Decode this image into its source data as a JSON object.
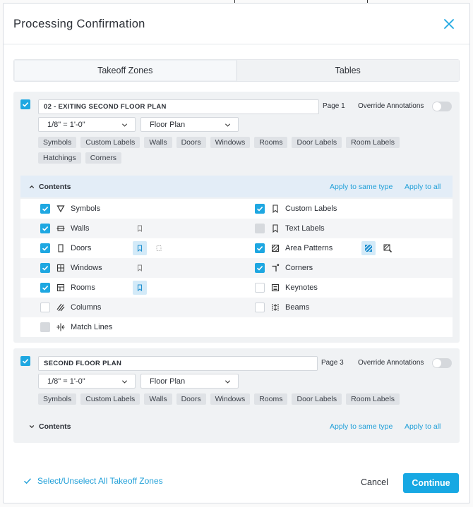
{
  "dialog": {
    "title": "Processing Confirmation"
  },
  "tabs": [
    {
      "label": "Takeoff Zones",
      "active": true
    },
    {
      "label": "Tables",
      "active": false
    }
  ],
  "zones": [
    {
      "checked": true,
      "name": "02 - EXITING SECOND FLOOR PLAN",
      "page": "Page 1",
      "override_label": "Override Annotations",
      "override_on": false,
      "scale": "1/8\" = 1'-0\"",
      "type": "Floor Plan",
      "chips": [
        "Symbols",
        "Custom Labels",
        "Walls",
        "Doors",
        "Windows",
        "Rooms",
        "Door Labels",
        "Room Labels",
        "Hatchings",
        "Corners"
      ],
      "contents_label": "Contents",
      "contents_expanded": true,
      "apply_same_type": "Apply to same type",
      "apply_all": "Apply to all",
      "contents": {
        "left": [
          {
            "label": "Symbols",
            "icon": "triangle-down-icon",
            "state": "on"
          },
          {
            "label": "Walls",
            "icon": "wall-icon",
            "state": "on"
          },
          {
            "label": "Doors",
            "icon": "door-icon",
            "state": "on"
          },
          {
            "label": "Windows",
            "icon": "window-icon",
            "state": "on"
          },
          {
            "label": "Rooms",
            "icon": "room-icon",
            "state": "on"
          },
          {
            "label": "Columns",
            "icon": "columns-icon",
            "state": "off"
          },
          {
            "label": "Match Lines",
            "icon": "match-lines-icon",
            "state": "disabled"
          }
        ],
        "right": [
          {
            "label": "Custom Labels",
            "icon": "bookmark-icon",
            "state": "on"
          },
          {
            "label": "Text Labels",
            "icon": "bookmark-icon",
            "state": "disabled"
          },
          {
            "label": "Area Patterns",
            "icon": "hatch-icon",
            "state": "on"
          },
          {
            "label": "Corners",
            "icon": "corner-icon",
            "state": "on"
          },
          {
            "label": "Keynotes",
            "icon": "keynote-icon",
            "state": "off"
          },
          {
            "label": "Beams",
            "icon": "beam-icon",
            "state": "off"
          }
        ]
      }
    },
    {
      "checked": true,
      "name": "SECOND FLOOR PLAN",
      "page": "Page 3",
      "override_label": "Override Annotations",
      "override_on": false,
      "scale": "1/8\" = 1'-0\"",
      "type": "Floor Plan",
      "chips": [
        "Symbols",
        "Custom Labels",
        "Walls",
        "Doors",
        "Windows",
        "Rooms",
        "Door Labels",
        "Room Labels"
      ],
      "contents_label": "Contents",
      "contents_expanded": false,
      "apply_same_type": "Apply to same type",
      "apply_all": "Apply to all"
    }
  ],
  "footer": {
    "select_all": "Select/Unselect All Takeoff Zones",
    "cancel": "Cancel",
    "continue": "Continue"
  },
  "colors": {
    "accent": "#1ea7e1",
    "link": "#1f9fd8"
  }
}
